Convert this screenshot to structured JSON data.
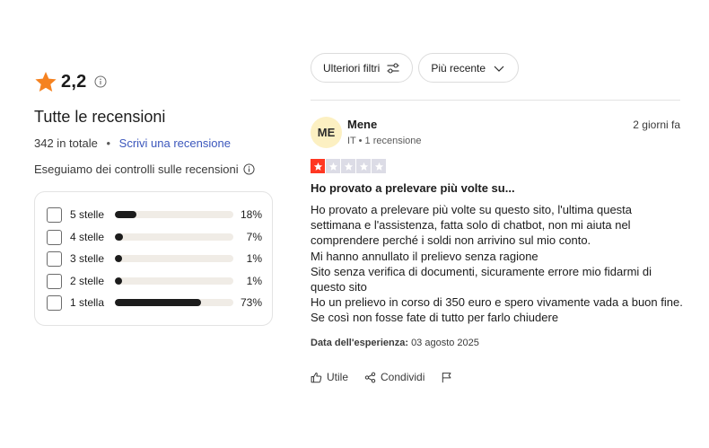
{
  "summary": {
    "score": "2,2",
    "title": "Tutte le recensioni",
    "total": "342 in totale",
    "write_review": "Scrivi una recensione",
    "checks_note": "Eseguiamo dei controlli sulle recensioni",
    "icons": {
      "rating": "star-icon",
      "info": "info-icon"
    },
    "accent_color": "#f58220",
    "link_color": "#3c57bc",
    "distribution": [
      {
        "label": "5 stelle",
        "pct_text": "18%",
        "value": 18
      },
      {
        "label": "4 stelle",
        "pct_text": "7%",
        "value": 7
      },
      {
        "label": "3 stelle",
        "pct_text": "1%",
        "value": 1
      },
      {
        "label": "2 stelle",
        "pct_text": "1%",
        "value": 1
      },
      {
        "label": "1 stella",
        "pct_text": "73%",
        "value": 73
      }
    ]
  },
  "toolbar": {
    "filters_label": "Ulteriori filtri",
    "filters_icon": "sliders-icon",
    "sort_label": "Più recente",
    "sort_icon": "chevron-down-icon"
  },
  "review": {
    "avatar_initials": "ME",
    "avatar_color": "#fcf0c2",
    "author": "Mene",
    "meta": "IT • 1 recensione",
    "posted": "2 giorni fa",
    "rating": 1,
    "rating_max": 5,
    "star_fill_color": "#ff3722",
    "title": "Ho provato a prelevare più volte su...",
    "body_lines": [
      "Ho provato a prelevare più volte su questo sito, l'ultima questa",
      "settimana e l'assistenza, fatta solo di chatbot, non mi aiuta nel",
      "comprendere perché i soldi non arrivino sul mio conto.",
      "Mi hanno annullato il prelievo senza ragione",
      "Sito senza verifica di documenti, sicuramente errore mio fidarmi di",
      "questo sito",
      "Ho un prelievo in corso di 350 euro e spero vivamente vada a buon fine.",
      "Se così non fosse fate di tutto per farlo chiudere"
    ],
    "experience_label": "Data dell'esperienza:",
    "experience_date": "03 agosto 2025",
    "actions": {
      "useful": "Utile",
      "useful_icon": "thumbs-up-icon",
      "share": "Condividi",
      "share_icon": "share-icon",
      "report_icon": "flag-icon"
    }
  }
}
